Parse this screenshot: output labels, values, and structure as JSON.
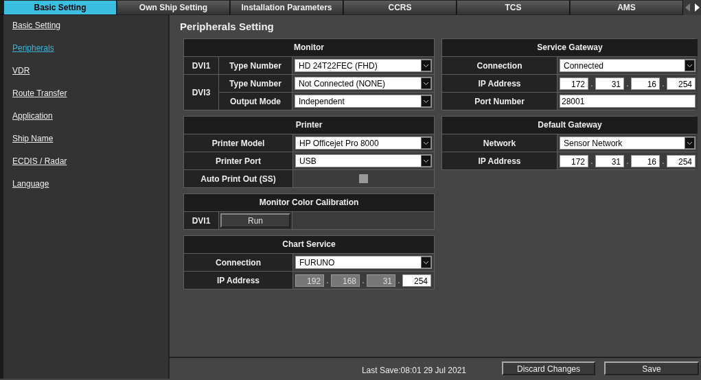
{
  "tabs": [
    {
      "label": "Basic Setting",
      "selected": true
    },
    {
      "label": "Own Ship Setting",
      "selected": false
    },
    {
      "label": "Installation Parameters",
      "selected": false
    },
    {
      "label": "CCRS",
      "selected": false
    },
    {
      "label": "TCS",
      "selected": false
    },
    {
      "label": "AMS",
      "selected": false
    }
  ],
  "tab_scroll": [
    {
      "kind": "left",
      "disabled": true
    },
    {
      "kind": "right",
      "disabled": false
    }
  ],
  "sidebar": {
    "items": [
      {
        "label": "Basic Setting",
        "selected": false
      },
      {
        "label": "Peripherals",
        "selected": true
      },
      {
        "label": "VDR",
        "selected": false
      },
      {
        "label": "Route Transfer",
        "selected": false
      },
      {
        "label": "Application",
        "selected": false
      },
      {
        "label": "Ship Name",
        "selected": false
      },
      {
        "label": "ECDIS / Radar",
        "selected": false
      },
      {
        "label": "Language",
        "selected": false
      }
    ]
  },
  "page_title": "Peripherals Setting",
  "columns": [
    {
      "panels": [
        {
          "title": "Monitor",
          "groups": [
            {
              "label": "DVI1",
              "rows": [
                {
                  "label": "Type Number",
                  "kind": "select",
                  "value": "HD 24T22FEC (FHD)"
                }
              ]
            },
            {
              "label": "DVI3",
              "rows": [
                {
                  "label": "Type Number",
                  "kind": "select",
                  "value": "Not Connected (NONE)"
                },
                {
                  "label": "Output Mode",
                  "kind": "select",
                  "value": "Independent"
                }
              ]
            }
          ]
        },
        {
          "title": "Printer",
          "groups": [
            {
              "rows": [
                {
                  "label": "Printer Model",
                  "kind": "select",
                  "value": "HP Officejet Pro 8000"
                },
                {
                  "label": "Printer Port",
                  "kind": "select",
                  "value": "USB"
                },
                {
                  "label": "Auto Print Out (SS)",
                  "kind": "checkbox",
                  "checked": false
                }
              ]
            }
          ]
        },
        {
          "title": "Monitor Color Calibration",
          "groups": [
            {
              "label": "DVI1",
              "rows": [
                {
                  "kind": "button",
                  "text": "Run"
                }
              ]
            }
          ]
        },
        {
          "title": "Chart Service",
          "groups": [
            {
              "rows": [
                {
                  "label": "Connection",
                  "kind": "select",
                  "value": "FURUNO"
                },
                {
                  "label": "IP Address",
                  "kind": "ip",
                  "separator": ".",
                  "octets": [
                    {
                      "value": "192",
                      "disabled": true
                    },
                    {
                      "value": "168",
                      "disabled": true
                    },
                    {
                      "value": "31",
                      "disabled": true
                    },
                    {
                      "value": "254",
                      "disabled": false
                    }
                  ]
                }
              ]
            }
          ]
        }
      ]
    },
    {
      "panels": [
        {
          "title": "Service Gateway",
          "groups": [
            {
              "rows": [
                {
                  "label": "Connection",
                  "kind": "select",
                  "value": "Connected"
                },
                {
                  "label": "IP Address",
                  "kind": "ip",
                  "separator": ".",
                  "octets": [
                    {
                      "value": "172",
                      "disabled": false
                    },
                    {
                      "value": "31",
                      "disabled": false
                    },
                    {
                      "value": "16",
                      "disabled": false
                    },
                    {
                      "value": "254",
                      "disabled": false
                    }
                  ]
                },
                {
                  "label": "Port Number",
                  "kind": "text",
                  "value": "28001"
                }
              ]
            }
          ]
        },
        {
          "title": "Default Gateway",
          "groups": [
            {
              "rows": [
                {
                  "label": "Network",
                  "kind": "select",
                  "value": "Sensor Network"
                },
                {
                  "label": "IP Address",
                  "kind": "ip",
                  "separator": ".",
                  "octets": [
                    {
                      "value": "172",
                      "disabled": false
                    },
                    {
                      "value": "31",
                      "disabled": false
                    },
                    {
                      "value": "16",
                      "disabled": false
                    },
                    {
                      "value": "254",
                      "disabled": false
                    }
                  ]
                }
              ]
            }
          ]
        }
      ]
    }
  ],
  "footer": {
    "last_save": "Last Save:08:01 29 Jul 2021",
    "buttons": [
      "Discard Changes",
      "Save"
    ]
  }
}
